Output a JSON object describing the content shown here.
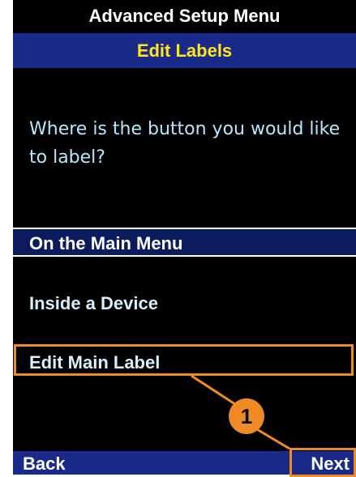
{
  "header": {
    "title": "Advanced Setup Menu",
    "subtitle": "Edit Labels"
  },
  "prompt": "Where is the button you would like to label?",
  "menu": {
    "items": [
      {
        "label": "On the Main Menu",
        "selected": true
      },
      {
        "label": "Inside a Device",
        "selected": false
      },
      {
        "label": "Edit Main Label",
        "selected": false
      }
    ]
  },
  "softkeys": {
    "left_label": "Back",
    "right_label": "Next"
  },
  "annotation": {
    "callout_number": "1",
    "highlight_color": "#f08a24"
  },
  "colors": {
    "screen_background": "#000000",
    "bar_blue": "#1a2a8a",
    "subtitle_yellow": "#ffe61a",
    "prompt_text": "#b5e8ff"
  }
}
